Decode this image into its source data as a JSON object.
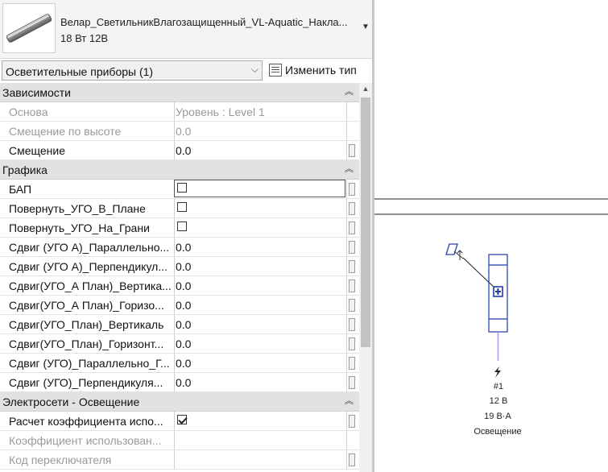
{
  "type_selector": {
    "name": "Велар_СветильникВлагозащищенный_VL-Aquatic_Накла...",
    "subtitle": "18 Вт 12В"
  },
  "filter": {
    "label": "Осветительные приборы (1)",
    "edit_type_label": "Изменить тип"
  },
  "sections": {
    "constraints": {
      "title": "Зависимости",
      "rows": [
        {
          "name": "Основа",
          "value": "Уровень : Level 1"
        },
        {
          "name": "Смещение по высоте",
          "value": "0.0"
        },
        {
          "name": "Смещение",
          "value": "0.0"
        }
      ]
    },
    "graphics": {
      "title": "Графика",
      "rows": [
        {
          "name": "БАП",
          "value": ""
        },
        {
          "name": "Повернуть_УГО_В_Плане",
          "value": ""
        },
        {
          "name": "Повернуть_УГО_На_Грани",
          "value": ""
        },
        {
          "name": "Сдвиг (УГО А)_Параллельно...",
          "value": "0.0"
        },
        {
          "name": "Сдвиг (УГО А)_Перпендикул...",
          "value": "0.0"
        },
        {
          "name": "Сдвиг(УГО_А План)_Вертика...",
          "value": "0.0"
        },
        {
          "name": "Сдвиг(УГО_А План)_Горизо...",
          "value": "0.0"
        },
        {
          "name": "Сдвиг(УГО_План)_Вертикаль",
          "value": "0.0"
        },
        {
          "name": "Сдвиг(УГО_План)_Горизонт...",
          "value": "0.0"
        },
        {
          "name": "Сдвиг (УГО)_Параллельно_Г...",
          "value": "0.0"
        },
        {
          "name": "Сдвиг (УГО)_Перпендикуля...",
          "value": "0.0"
        }
      ]
    },
    "electrical": {
      "title": "Электросети - Освещение",
      "rows": [
        {
          "name": "Расчет коэффициента испо...",
          "value": ""
        },
        {
          "name": "Коэффициент использован...",
          "value": ""
        },
        {
          "name": "Код переключателя",
          "value": ""
        }
      ]
    }
  },
  "drawing": {
    "tag_number": "#1",
    "tag_voltage": "12 В",
    "tag_load": "19 В·А",
    "tag_system": "Освещение"
  },
  "colors": {
    "section_bg": "#e2e2e2",
    "fixture_blue": "#1f3aa8",
    "circuit_line": "#9b9bf0"
  }
}
